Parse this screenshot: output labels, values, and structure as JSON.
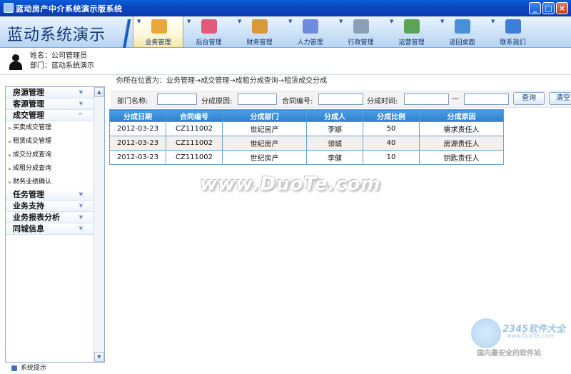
{
  "window": {
    "title": "蓝动房产中介系统演示版系统"
  },
  "header": {
    "brand": "蓝动系统演示",
    "nav": [
      {
        "label": "业务管理",
        "icon": "folder-icon",
        "color": "#e8a93a"
      },
      {
        "label": "后台管理",
        "icon": "shopping-bag-icon",
        "color": "#e05a7a"
      },
      {
        "label": "财务管理",
        "icon": "coins-icon",
        "color": "#d79a3a"
      },
      {
        "label": "人力管理",
        "icon": "people-icon",
        "color": "#6f8be0"
      },
      {
        "label": "行政管理",
        "icon": "admin-icon",
        "color": "#8aa0b8"
      },
      {
        "label": "运营管理",
        "icon": "bar-chart-icon",
        "color": "#5aa45a"
      },
      {
        "label": "返回桌面",
        "icon": "desktop-icon",
        "color": "#4a90d9"
      },
      {
        "label": "联系我们",
        "icon": "contact-icon",
        "color": "#3d7fd6"
      }
    ]
  },
  "user": {
    "name_label": "姓名：公司管理员",
    "dept_label": "部门：蓝动系统演示"
  },
  "sidebar": {
    "sections": [
      {
        "label": "房源管理"
      },
      {
        "label": "客源管理"
      },
      {
        "label": "成交管理"
      }
    ],
    "items": [
      "买卖成交管理",
      "租赁成交管理",
      "成交分成查询",
      "成租分成查询",
      "财务业绩确认"
    ],
    "sections2": [
      {
        "label": "任务管理"
      },
      {
        "label": "业务支持"
      },
      {
        "label": "业务报表分析"
      },
      {
        "label": "同城信息"
      }
    ],
    "footer": "系统提示"
  },
  "breadcrumb": "你所在位置为：业务管理→成交管理→成租分成查询→租赁成交分成",
  "filter": {
    "dept_label": "部门名称:",
    "reason_label": "分成原因:",
    "contract_label": "合同编号:",
    "time_label": "分成时间:",
    "dash": "—",
    "query_button": "查询",
    "clear_button": "清空"
  },
  "table": {
    "headers": [
      "分成日期",
      "合同编号",
      "分成部门",
      "分成人",
      "分成比例",
      "分成原因"
    ],
    "rows": [
      [
        "2012-03-23",
        "CZ111002",
        "世纪房产",
        "李娜",
        "50",
        "需求责任人"
      ],
      [
        "2012-03-23",
        "CZ111002",
        "世纪房产",
        "领城",
        "40",
        "房源责任人"
      ],
      [
        "2012-03-23",
        "CZ111002",
        "世纪房产",
        "李健",
        "10",
        "钥匙责任人"
      ]
    ]
  },
  "watermark": "www.DuoTe.com",
  "logo": {
    "brand": "2345软件大全",
    "url": "www.DuoTe.com",
    "slogan": "国内最安全的软件站"
  }
}
